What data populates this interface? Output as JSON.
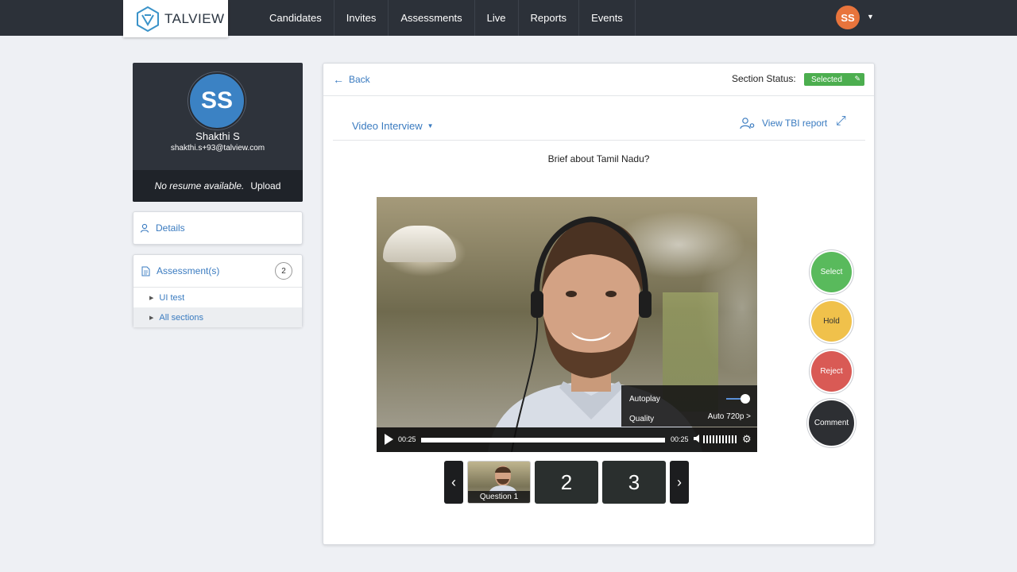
{
  "brand": {
    "name": "TALVIEW"
  },
  "nav": {
    "items": [
      "Candidates",
      "Invites",
      "Assessments",
      "Live",
      "Reports",
      "Events"
    ],
    "user_initials": "SS"
  },
  "profile": {
    "initials": "SS",
    "name": "Shakthi S",
    "email": "shakthi.s+93@talview.com",
    "no_resume": "No resume available.",
    "upload": "Upload"
  },
  "sidebar": {
    "details": "Details",
    "assessments_label": "Assessment(s)",
    "assessments_count": "2",
    "assessment_items": [
      "UI test",
      "All sections"
    ]
  },
  "main": {
    "back": "Back",
    "section_status_label": "Section Status:",
    "section_status_value": "Selected",
    "section_title": "Video Interview",
    "view_report": "View TBI report",
    "question": "Brief about Tamil Nadu?"
  },
  "player": {
    "autoplay_label": "Autoplay",
    "autoplay_on": true,
    "quality_label": "Quality",
    "quality_value": "Auto 720p >",
    "current_time": "00:25",
    "duration": "00:25",
    "progress": 1.0
  },
  "thumbnails": {
    "items": [
      {
        "caption": "Question 1",
        "number": ""
      },
      {
        "caption": "",
        "number": "2"
      },
      {
        "caption": "",
        "number": "3"
      }
    ]
  },
  "actions": {
    "select": "Select",
    "hold": "Hold",
    "reject": "Reject",
    "comment": "Comment"
  },
  "colors": {
    "accent": "#3a7bc0",
    "topbar": "#2c3139",
    "selected_green": "#4cae4f",
    "hold_yellow": "#f0c14b",
    "reject_red": "#d95a55",
    "avatar_orange": "#e8743c"
  }
}
